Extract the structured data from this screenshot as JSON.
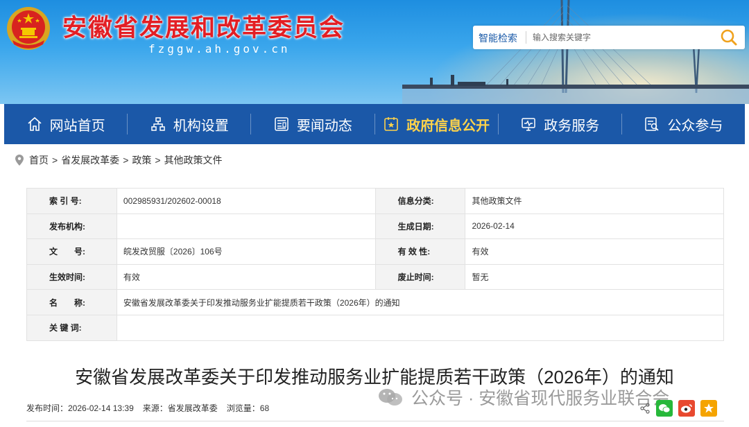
{
  "header": {
    "site_title": "安徽省发展和改革委员会",
    "site_domain": "fzggw.ah.gov.cn",
    "search": {
      "label": "智能检索",
      "placeholder": "输入搜索关键字"
    }
  },
  "nav": {
    "items": [
      {
        "label": "网站首页",
        "icon": "home-icon"
      },
      {
        "label": "机构设置",
        "icon": "org-chart-icon"
      },
      {
        "label": "要闻动态",
        "icon": "news-icon"
      },
      {
        "label": "政府信息公开",
        "icon": "info-disclosure-icon",
        "active": true
      },
      {
        "label": "政务服务",
        "icon": "monitor-service-icon"
      },
      {
        "label": "公众参与",
        "icon": "participation-icon"
      }
    ],
    "active_color": "#ffd34a",
    "bar_color": "#1b58a8"
  },
  "breadcrumb": [
    "首页",
    "省发展改革委",
    "政策",
    "其他政策文件"
  ],
  "info": {
    "index_no_label": "索 引 号:",
    "index_no": "002985931/202602-00018",
    "category_label": "信息分类:",
    "category": "其他政策文件",
    "publisher_label": "发布机构:",
    "publisher": "",
    "created_label": "生成日期:",
    "created": "2026-02-14",
    "doc_no_label": "文　　号:",
    "doc_no": "皖发改贸服〔2026〕106号",
    "validity_label": "有 效 性:",
    "validity": "有效",
    "effective_label": "生效时间:",
    "effective": "有效",
    "expire_label": "废止时间:",
    "expire": "暂无",
    "name_label": "名　　称:",
    "name": "安徽省发展改革委关于印发推动服务业扩能提质若干政策（2026年）的通知",
    "keywords_label": "关 键 词:",
    "keywords": ""
  },
  "article": {
    "title": "安徽省发展改革委关于印发推动服务业扩能提质若干政策（2026年）的通知",
    "publish_time": "发布时间：2026-02-14 13:39",
    "source": "来源：省发展改革委",
    "views": "浏览量：68"
  },
  "watermark": {
    "text": "公众号 · 安徽省现代服务业联合会"
  }
}
